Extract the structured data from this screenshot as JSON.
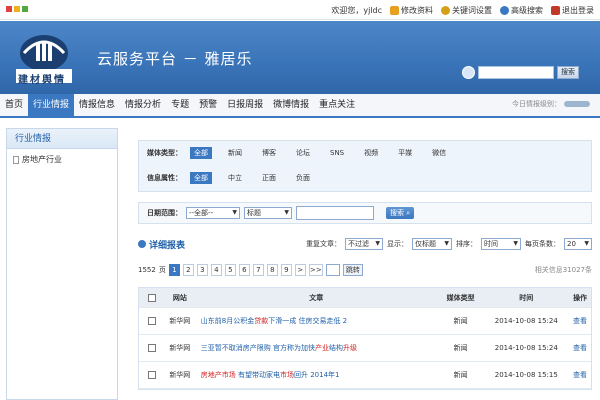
{
  "topbar": {
    "welcome": "欢迎您，yjldc",
    "links": [
      {
        "label": "修改资料",
        "icon": "edit-icon",
        "color": "#e8a020"
      },
      {
        "label": "关键词设置",
        "icon": "key-icon",
        "color": "#d4a017"
      },
      {
        "label": "高级搜索",
        "icon": "advanced-search-icon",
        "color": "#3b78c2"
      },
      {
        "label": "退出登录",
        "icon": "logout-icon",
        "color": "#c0392b"
      }
    ]
  },
  "banner": {
    "logo_text": "建材舆情",
    "title": "云服务平台 － 雅居乐",
    "search_button": "搜索"
  },
  "nav": {
    "items": [
      "首页",
      "行业情报",
      "情报信息",
      "情报分析",
      "专题",
      "预警",
      "日报周报",
      "微博情报",
      "重点关注"
    ],
    "active_index": 1,
    "today_label": "今日情报级别："
  },
  "sidebar": {
    "title": "行业情报",
    "items": [
      "房地产行业"
    ]
  },
  "filters": {
    "media_label": "媒体类型：",
    "media_options": [
      "全部",
      "新闻",
      "博客",
      "论坛",
      "SNS",
      "视频",
      "平媒",
      "微信"
    ],
    "media_selected": 0,
    "attr_label": "信息属性：",
    "attr_options": [
      "全部",
      "中立",
      "正面",
      "负面"
    ],
    "attr_selected": 0
  },
  "date_row": {
    "label": "日期范围：",
    "range_select": "--全部--",
    "field_select": "标题",
    "search_button": "搜索"
  },
  "report": {
    "title": "详细报表",
    "dup_label": "重复文章：",
    "dup_value": "不过滤",
    "show_label": "显示：",
    "show_value": "仅标题",
    "sort_label": "排序：",
    "sort_value": "时间",
    "per_page_label": "每页条数：",
    "per_page_value": "20"
  },
  "pager": {
    "total_pages": "1552",
    "page_unit": "页",
    "pages": [
      "1",
      "2",
      "3",
      "4",
      "5",
      "6",
      "7",
      "8",
      "9"
    ],
    "current": 0,
    "next": ">",
    "last": ">>",
    "jump_label": "跳转",
    "total_text": "相关信息31027条"
  },
  "table": {
    "headers": {
      "site": "网站",
      "article": "文章",
      "type": "媒体类型",
      "time": "时间",
      "op": "操作"
    },
    "rows": [
      {
        "site": "新华网",
        "title_parts": [
          {
            "t": "山东前8月公积金",
            "c": "blue"
          },
          {
            "t": "贷款",
            "c": "red"
          },
          {
            "t": "下滑一成 住房交易走低 2",
            "c": "blue"
          }
        ],
        "type": "新闻",
        "time": "2014-10-08 15:24",
        "op": "查看"
      },
      {
        "site": "新华网",
        "title_parts": [
          {
            "t": "三亚暂不取消房产限购 官方称为加快",
            "c": "blue"
          },
          {
            "t": "产业",
            "c": "red"
          },
          {
            "t": "结构",
            "c": "blue"
          },
          {
            "t": "升级",
            "c": "red"
          }
        ],
        "type": "新闻",
        "time": "2014-10-08 15:24",
        "op": "查看"
      },
      {
        "site": "新华网",
        "title_parts": [
          {
            "t": "房地产市场",
            "c": "red"
          },
          {
            "t": " 有望带动家电",
            "c": "blue"
          },
          {
            "t": "市场",
            "c": "red"
          },
          {
            "t": "回升 2014年1",
            "c": "blue"
          }
        ],
        "type": "新闻",
        "time": "2014-10-08 15:15",
        "op": "查看"
      }
    ]
  }
}
